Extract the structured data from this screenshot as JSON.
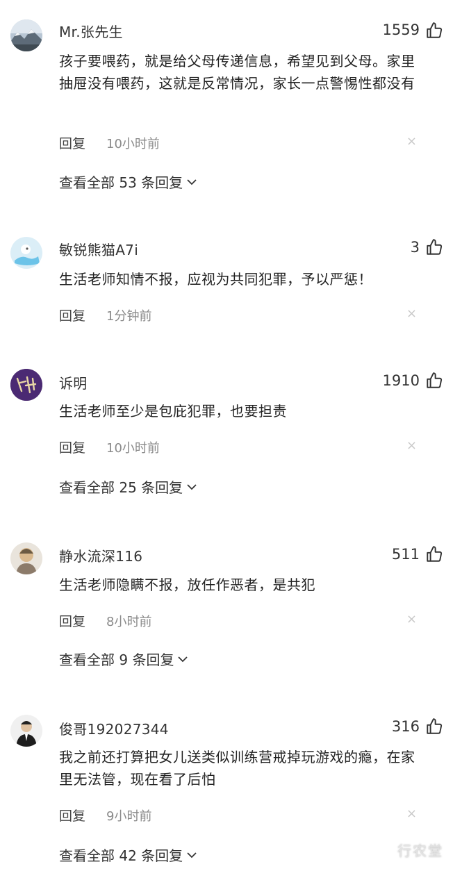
{
  "comments": [
    {
      "name": "Mr.张先生",
      "likes": "1559",
      "text": "孩子要喂药，就是给父母传递信息，希望见到父母。家里抽屉没有喂药，这就是反常情况，家长一点警惕性都没有",
      "reply_label": "回复",
      "time": "10小时前",
      "view_all": "查看全部 53 条回复"
    },
    {
      "name": "敏锐熊猫A7i",
      "likes": "3",
      "text": "生活老师知情不报，应视为共同犯罪，予以严惩！",
      "reply_label": "回复",
      "time": "1分钟前"
    },
    {
      "name": "诉明",
      "likes": "1910",
      "text": "生活老师至少是包庇犯罪，也要担责",
      "reply_label": "回复",
      "time": "10小时前",
      "view_all": "查看全部 25 条回复"
    },
    {
      "name": "静水流深116",
      "likes": "511",
      "text": "生活老师隐瞒不报，放任作恶者，是共犯",
      "reply_label": "回复",
      "time": "8小时前",
      "view_all": "查看全部 9 条回复"
    },
    {
      "name": "俊哥192027344",
      "likes": "316",
      "text": "我之前还打算把女儿送类似训练营戒掉玩游戏的瘾，在家里无法管，现在看了后怕",
      "reply_label": "回复",
      "time": "9小时前",
      "view_all": "查看全部 42 条回复"
    }
  ],
  "close_glyph": "×",
  "watermark": "行农堂",
  "icons": {
    "like": "thumbs-up-icon",
    "expand": "chevron-down-icon",
    "delete": "close-icon"
  },
  "colors": {
    "text": "#222222",
    "muted": "#8a8a8a",
    "icon": "#333333",
    "close": "#c9c9c9"
  }
}
